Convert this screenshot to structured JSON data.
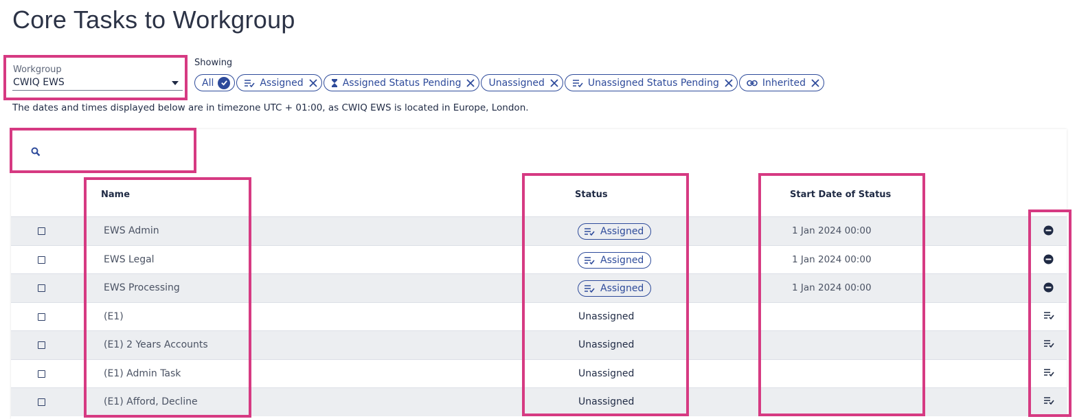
{
  "page": {
    "title": "Core Tasks to Workgroup"
  },
  "workgroup": {
    "label": "Workgroup",
    "value": "CWIQ EWS"
  },
  "filters": {
    "label": "Showing",
    "chips": [
      {
        "label": "All",
        "icon": "check-circle-icon"
      },
      {
        "label": "Assigned",
        "icon": "assigned-list-icon"
      },
      {
        "label": "Assigned Status Pending",
        "icon": "hourglass-icon"
      },
      {
        "label": "Unassigned",
        "icon": ""
      },
      {
        "label": "Unassigned Status Pending",
        "icon": "assigned-list-icon"
      },
      {
        "label": "Inherited",
        "icon": "link-icon"
      }
    ]
  },
  "note": "The dates and times displayed below are in timezone UTC + 01:00, as CWIQ EWS is located in Europe, London.",
  "table": {
    "columns": {
      "name": "Name",
      "status": "Status",
      "start_date": "Start Date of Status"
    },
    "rows": [
      {
        "name": "EWS Admin",
        "status": "Assigned",
        "start_date": "1 Jan 2024 00:00",
        "action_icon": "remove-circle-icon"
      },
      {
        "name": "EWS Legal",
        "status": "Assigned",
        "start_date": "1 Jan 2024 00:00",
        "action_icon": "remove-circle-icon"
      },
      {
        "name": "EWS Processing",
        "status": "Assigned",
        "start_date": "1 Jan 2024 00:00",
        "action_icon": "remove-circle-icon"
      },
      {
        "name": "(E1)",
        "status": "Unassigned",
        "start_date": "",
        "action_icon": "assign-list-icon"
      },
      {
        "name": "(E1) 2 Years Accounts",
        "status": "Unassigned",
        "start_date": "",
        "action_icon": "assign-list-icon"
      },
      {
        "name": "(E1) Admin Task",
        "status": "Unassigned",
        "start_date": "",
        "action_icon": "assign-list-icon"
      },
      {
        "name": "(E1) Afford, Decline",
        "status": "Unassigned",
        "start_date": "",
        "action_icon": "assign-list-icon"
      }
    ]
  },
  "colors": {
    "accent": "#2d4a9a",
    "highlight": "#d63a82",
    "row_shade": "#eceef1"
  }
}
